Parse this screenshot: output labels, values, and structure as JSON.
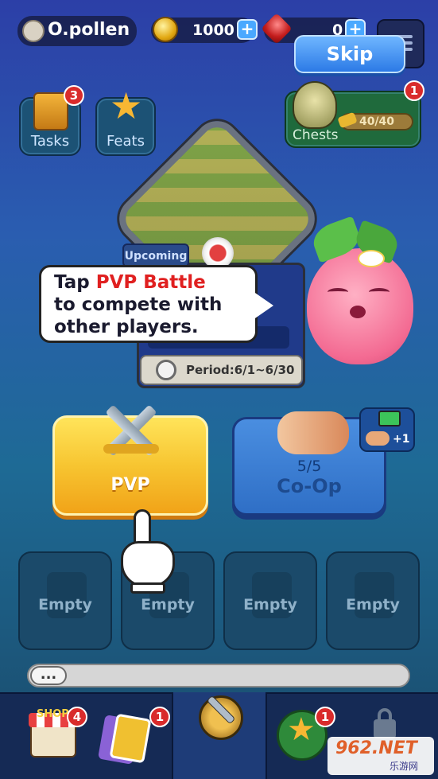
{
  "header": {
    "username": "O.pollen",
    "coins": "1000",
    "gems": "0",
    "skip_label": "Skip"
  },
  "tiles": {
    "tasks_label": "Tasks",
    "tasks_badge": "3",
    "feats_label": "Feats",
    "chests_label": "Chests",
    "chests_badge": "1",
    "chests_progress": "40/40"
  },
  "event": {
    "status": "Upcoming",
    "period": "Period:6/1~6/30"
  },
  "tooltip": {
    "line1_prefix": "Tap ",
    "line1_highlight": "PVP Battle",
    "line2": "to compete with",
    "line3": "other players."
  },
  "modes": {
    "pvp_label": "PVP",
    "coop_count": "5/5",
    "coop_label": "Co-Op",
    "coop_bonus": "+1"
  },
  "slots": [
    "Empty",
    "Empty",
    "Empty",
    "Empty"
  ],
  "chat": {
    "icon": "..."
  },
  "nav": {
    "shop_label": "SHOP",
    "shop_badge": "4",
    "cards_badge": "1",
    "rank_badge": "1"
  },
  "watermark": {
    "text": "962.NET",
    "sub": "乐游网"
  },
  "colors": {
    "pvp_yellow": "#f7c531",
    "coop_blue": "#2f6fc6",
    "skip_blue": "#3d8ff0",
    "badge_red": "#d92b2b",
    "highlight_red": "#e02020"
  }
}
